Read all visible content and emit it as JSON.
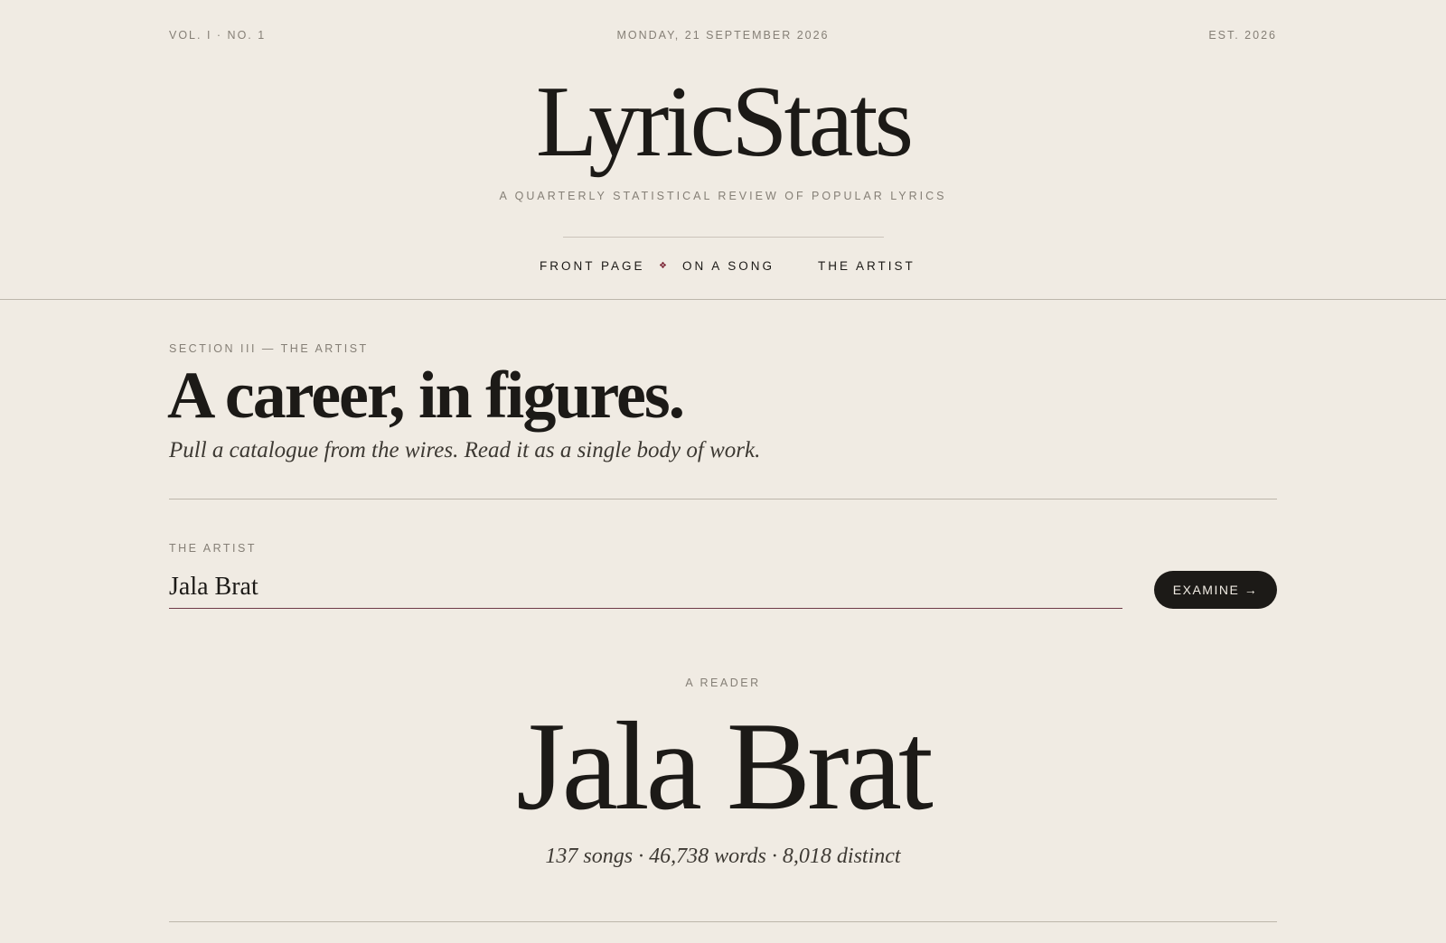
{
  "masthead": {
    "volume": "VOL. I · NO. 1",
    "date": "MONDAY, 21 SEPTEMBER 2026",
    "established": "EST. 2026",
    "logo": "LyricStats",
    "tagline": "A QUARTERLY STATISTICAL REVIEW OF POPULAR LYRICS"
  },
  "nav": {
    "items": [
      {
        "label": "FRONT PAGE"
      },
      {
        "label": "ON A SONG"
      },
      {
        "label": "THE ARTIST"
      }
    ],
    "separator": "❖"
  },
  "section": {
    "kicker": "SECTION III — THE ARTIST",
    "title": "A career, in figures.",
    "deck": "Pull a catalogue from the wires. Read it as a single body of work."
  },
  "search": {
    "label": "THE ARTIST",
    "value": "Jala Brat",
    "button_label": "EXAMINE →"
  },
  "result": {
    "kicker": "A READER",
    "artist_name": "Jala Brat",
    "stats": "137 songs · 46,738 words · 8,018 distinct"
  },
  "colors": {
    "background": "#f0ebe3",
    "ink": "#1c1a17",
    "muted": "#857f76",
    "accent": "#7a2435"
  }
}
